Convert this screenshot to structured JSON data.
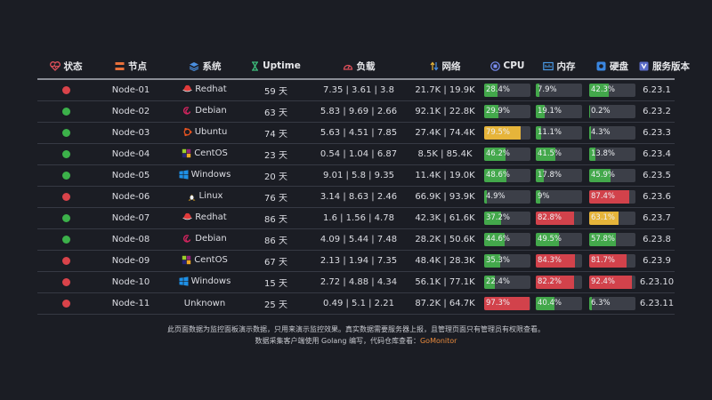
{
  "headers": {
    "status": "状态",
    "node": "节点",
    "system": "系统",
    "uptime": "Uptime",
    "load": "负载",
    "network": "网络",
    "cpu": "CPU",
    "memory": "内存",
    "disk": "硬盘",
    "version": "服务版本"
  },
  "colors": {
    "online": "#3cb14a",
    "offline": "#d9434a",
    "bar_green": "#43a84b",
    "bar_yellow": "#e6b43a",
    "bar_red": "#d2424b"
  },
  "rows": [
    {
      "status": "offline",
      "node": "Node-01",
      "os": "Redhat",
      "os_icon": "redhat-icon",
      "uptime": "59 天",
      "load": "7.35 | 3.61 | 3.8",
      "net": "21.7K | 19.9K",
      "cpu": {
        "text": "28.4%",
        "value": 28.4,
        "color": "green"
      },
      "mem": {
        "text": "7.9%",
        "value": 7.9,
        "color": "green"
      },
      "disk": {
        "text": "42.3%",
        "value": 42.3,
        "color": "green"
      },
      "version": "6.23.1"
    },
    {
      "status": "online",
      "node": "Node-02",
      "os": "Debian",
      "os_icon": "debian-icon",
      "uptime": "63 天",
      "load": "5.83 | 9.69 | 2.66",
      "net": "92.1K | 22.8K",
      "cpu": {
        "text": "29.9%",
        "value": 29.9,
        "color": "green"
      },
      "mem": {
        "text": "19.1%",
        "value": 19.1,
        "color": "green"
      },
      "disk": {
        "text": "0.2%",
        "value": 0.2,
        "color": "green"
      },
      "version": "6.23.2"
    },
    {
      "status": "online",
      "node": "Node-03",
      "os": "Ubuntu",
      "os_icon": "ubuntu-icon",
      "uptime": "74 天",
      "load": "5.63 | 4.51 | 7.85",
      "net": "27.4K | 74.4K",
      "cpu": {
        "text": "79.5%",
        "value": 79.5,
        "color": "yellow"
      },
      "mem": {
        "text": "11.1%",
        "value": 11.1,
        "color": "green"
      },
      "disk": {
        "text": "4.3%",
        "value": 4.3,
        "color": "green"
      },
      "version": "6.23.3"
    },
    {
      "status": "online",
      "node": "Node-04",
      "os": "CentOS",
      "os_icon": "centos-icon",
      "uptime": "23 天",
      "load": "0.54 | 1.04 | 6.87",
      "net": "8.5K | 85.4K",
      "cpu": {
        "text": "46.2%",
        "value": 46.2,
        "color": "green"
      },
      "mem": {
        "text": "41.5%",
        "value": 41.5,
        "color": "green"
      },
      "disk": {
        "text": "13.8%",
        "value": 13.8,
        "color": "green"
      },
      "version": "6.23.4"
    },
    {
      "status": "online",
      "node": "Node-05",
      "os": "Windows",
      "os_icon": "windows-icon",
      "uptime": "20 天",
      "load": "9.01 | 5.8 | 9.35",
      "net": "11.4K | 19.0K",
      "cpu": {
        "text": "48.6%",
        "value": 48.6,
        "color": "green"
      },
      "mem": {
        "text": "17.8%",
        "value": 17.8,
        "color": "green"
      },
      "disk": {
        "text": "45.9%",
        "value": 45.9,
        "color": "green"
      },
      "version": "6.23.5"
    },
    {
      "status": "offline",
      "node": "Node-06",
      "os": "Linux",
      "os_icon": "linux-icon",
      "uptime": "76 天",
      "load": "3.14 | 8.63 | 2.46",
      "net": "66.9K | 93.9K",
      "cpu": {
        "text": "4.9%",
        "value": 4.9,
        "color": "green"
      },
      "mem": {
        "text": "9%",
        "value": 9,
        "color": "green"
      },
      "disk": {
        "text": "87.4%",
        "value": 87.4,
        "color": "red"
      },
      "version": "6.23.6"
    },
    {
      "status": "online",
      "node": "Node-07",
      "os": "Redhat",
      "os_icon": "redhat-icon",
      "uptime": "86 天",
      "load": "1.6 | 1.56 | 4.78",
      "net": "42.3K | 61.6K",
      "cpu": {
        "text": "37.2%",
        "value": 37.2,
        "color": "green"
      },
      "mem": {
        "text": "82.8%",
        "value": 82.8,
        "color": "red"
      },
      "disk": {
        "text": "63.1%",
        "value": 63.1,
        "color": "yellow"
      },
      "version": "6.23.7"
    },
    {
      "status": "online",
      "node": "Node-08",
      "os": "Debian",
      "os_icon": "debian-icon",
      "uptime": "86 天",
      "load": "4.09 | 5.44 | 7.48",
      "net": "28.2K | 50.6K",
      "cpu": {
        "text": "44.6%",
        "value": 44.6,
        "color": "green"
      },
      "mem": {
        "text": "49.5%",
        "value": 49.5,
        "color": "green"
      },
      "disk": {
        "text": "57.8%",
        "value": 57.8,
        "color": "green"
      },
      "version": "6.23.8"
    },
    {
      "status": "offline",
      "node": "Node-09",
      "os": "CentOS",
      "os_icon": "centos-icon",
      "uptime": "67 天",
      "load": "2.13 | 1.94 | 7.35",
      "net": "48.4K | 28.3K",
      "cpu": {
        "text": "35.3%",
        "value": 35.3,
        "color": "green"
      },
      "mem": {
        "text": "84.3%",
        "value": 84.3,
        "color": "red"
      },
      "disk": {
        "text": "81.7%",
        "value": 81.7,
        "color": "red"
      },
      "version": "6.23.9"
    },
    {
      "status": "offline",
      "node": "Node-10",
      "os": "Windows",
      "os_icon": "windows-icon",
      "uptime": "15 天",
      "load": "2.72 | 4.88 | 4.34",
      "net": "56.1K | 77.1K",
      "cpu": {
        "text": "22.4%",
        "value": 22.4,
        "color": "green"
      },
      "mem": {
        "text": "82.2%",
        "value": 82.2,
        "color": "red"
      },
      "disk": {
        "text": "92.4%",
        "value": 92.4,
        "color": "red"
      },
      "version": "6.23.10"
    },
    {
      "status": "offline",
      "node": "Node-11",
      "os": "Unknown",
      "os_icon": "",
      "uptime": "25 天",
      "load": "0.49 | 5.1 | 2.21",
      "net": "87.2K | 64.7K",
      "cpu": {
        "text": "97.3%",
        "value": 97.3,
        "color": "red"
      },
      "mem": {
        "text": "40.4%",
        "value": 40.4,
        "color": "green"
      },
      "disk": {
        "text": "6.3%",
        "value": 6.3,
        "color": "green"
      },
      "version": "6.23.11"
    }
  ],
  "footer": {
    "line1": "此页面数据为监控面板演示数据，只用来演示监控效果。真实数据需要服务器上报，且管理页面只有管理员有权限查看。",
    "line2": "数据采集客户端使用 Golang 编写，代码仓库查看：",
    "link": "GoMonitor"
  }
}
